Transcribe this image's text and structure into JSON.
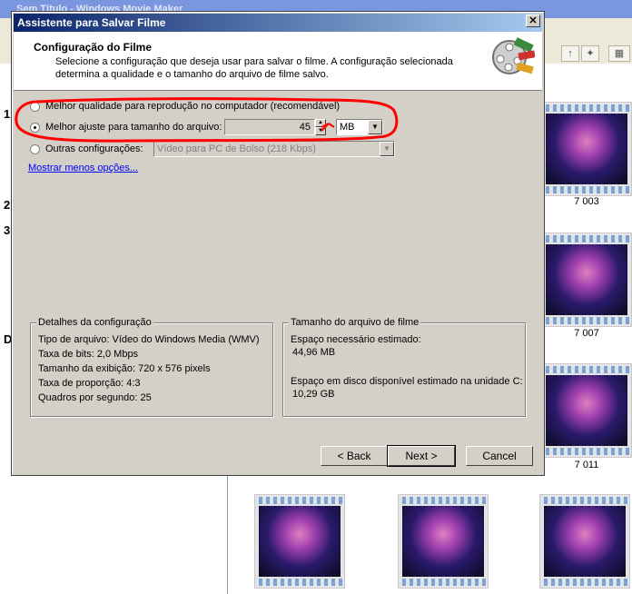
{
  "app": {
    "title": "Sem Título - Windows Movie Maker",
    "left_markers": [
      "1",
      "2",
      "3",
      "D"
    ],
    "thumbnails": [
      {
        "label": "7 003"
      },
      {
        "label": "7 007"
      },
      {
        "label": "7 011"
      }
    ]
  },
  "dialog": {
    "title": "Assistente para Salvar Filme",
    "close_glyph": "✕",
    "header": {
      "title": "Configuração do Filme",
      "subtitle": "Selecione a configuração que deseja usar para salvar o filme. A configuração selecionada determina a qualidade e o tamanho do arquivo de filme salvo."
    },
    "options": {
      "best_quality": "Melhor qualidade para reprodução no computador (recomendável)",
      "best_fit": "Melhor ajuste para tamanho do arquivo:",
      "other": "Outras configurações:",
      "selected": "best_fit"
    },
    "size_value": "45",
    "size_unit": "MB",
    "other_setting_value": "Vídeo para PC de Bolso (218 Kbps)",
    "show_less_link": "Mostrar menos opções...",
    "details": {
      "legend": "Detalhes da configuração",
      "lines": [
        "Tipo de arquivo: Vídeo do Windows Media (WMV)",
        "Taxa de bits: 2,0 Mbps",
        "Tamanho da exibição: 720 x 576 pixels",
        "Taxa de proporção: 4:3",
        "Quadros por segundo: 25"
      ]
    },
    "filesize": {
      "legend": "Tamanho do arquivo de filme",
      "needed_label": "Espaço necessário estimado:",
      "needed_value": "44,96 MB",
      "disk_label": "Espaço em disco disponível estimado na unidade C:",
      "disk_value": "10,29 GB"
    },
    "buttons": {
      "back": "< Back",
      "next": "Next >",
      "cancel": "Cancel"
    }
  },
  "colors": {
    "annotation": "#ff0000",
    "dialog_face": "#d4d0c8",
    "title_bar": "#0a246a"
  }
}
